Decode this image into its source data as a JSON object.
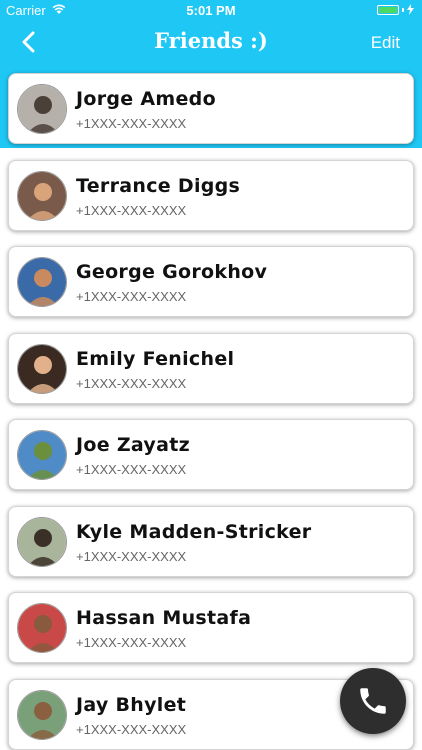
{
  "status_bar": {
    "carrier": "Carrier",
    "time": "5:01 PM",
    "battery_level": 1.0
  },
  "nav": {
    "title": "Friends :)",
    "edit_label": "Edit",
    "back_icon": "chevron-left-icon"
  },
  "contacts": [
    {
      "name": "Jorge Amedo",
      "phone": "+1XXX-XXX-XXXX",
      "avatar_bg": "#b5b0aa",
      "avatar_fg": "#4a4038"
    },
    {
      "name": "Terrance Diggs",
      "phone": "+1XXX-XXX-XXXX",
      "avatar_bg": "#7a5a4a",
      "avatar_fg": "#d9a47a"
    },
    {
      "name": "George Gorokhov",
      "phone": "+1XXX-XXX-XXXX",
      "avatar_bg": "#3b6aa8",
      "avatar_fg": "#c88a5e"
    },
    {
      "name": "Emily Fenichel",
      "phone": "+1XXX-XXX-XXXX",
      "avatar_bg": "#3a2a22",
      "avatar_fg": "#e2b08a"
    },
    {
      "name": "Joe Zayatz",
      "phone": "+1XXX-XXX-XXXX",
      "avatar_bg": "#4f8bc6",
      "avatar_fg": "#6b8f3c"
    },
    {
      "name": "Kyle Madden-Stricker",
      "phone": "+1XXX-XXX-XXXX",
      "avatar_bg": "#a9b59a",
      "avatar_fg": "#3a3028"
    },
    {
      "name": "Hassan Mustafa",
      "phone": "+1XXX-XXX-XXXX",
      "avatar_bg": "#c94848",
      "avatar_fg": "#8a5a3e"
    },
    {
      "name": "Jay Bhylet",
      "phone": "+1XXX-XXX-XXXX",
      "avatar_bg": "#7aa07a",
      "avatar_fg": "#8a6040"
    }
  ],
  "call_button_icon": "phone-icon",
  "colors": {
    "header": "#1fc7f5",
    "fab": "#2e2e2e",
    "battery": "#4cd964"
  }
}
